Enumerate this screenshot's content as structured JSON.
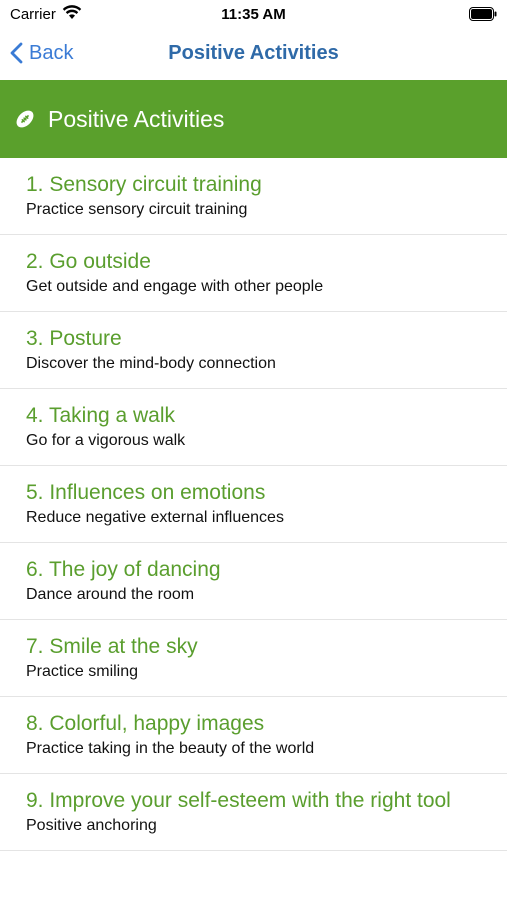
{
  "status": {
    "carrier": "Carrier",
    "time": "11:35 AM"
  },
  "nav": {
    "back_label": "Back",
    "title": "Positive Activities"
  },
  "header": {
    "title": "Positive Activities"
  },
  "colors": {
    "accent": "#5aa02c",
    "nav_blue": "#3a7bd5",
    "title_green": "#5a9e2e"
  },
  "items": [
    {
      "title": "1. Sensory circuit training",
      "subtitle": "Practice sensory circuit training"
    },
    {
      "title": "2. Go outside",
      "subtitle": "Get outside and engage with other people"
    },
    {
      "title": "3. Posture",
      "subtitle": "Discover the mind-body connection"
    },
    {
      "title": "4. Taking a walk",
      "subtitle": "Go for a vigorous walk"
    },
    {
      "title": "5. Influences on emotions",
      "subtitle": "Reduce negative external influences"
    },
    {
      "title": "6. The joy of dancing",
      "subtitle": "Dance around the room"
    },
    {
      "title": "7. Smile at the sky",
      "subtitle": "Practice smiling"
    },
    {
      "title": "8. Colorful, happy images",
      "subtitle": "Practice taking in the beauty of the world"
    },
    {
      "title": "9. Improve your self-esteem with the right tool",
      "subtitle": "Positive anchoring"
    }
  ]
}
